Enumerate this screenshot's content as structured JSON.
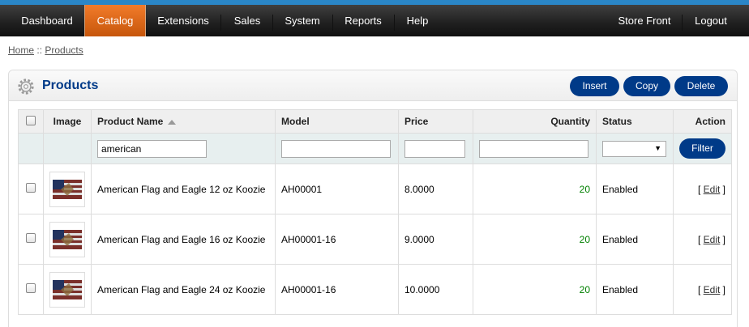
{
  "nav": {
    "left": [
      "Dashboard",
      "Catalog",
      "Extensions",
      "Sales",
      "System",
      "Reports",
      "Help"
    ],
    "right": [
      "Store Front",
      "Logout"
    ],
    "active": "Catalog"
  },
  "breadcrumb": {
    "home": "Home",
    "separator": "::",
    "current": "Products"
  },
  "panel": {
    "title": "Products",
    "buttons": {
      "insert": "Insert",
      "copy": "Copy",
      "delete": "Delete"
    }
  },
  "table": {
    "headers": {
      "image": "Image",
      "name": "Product Name",
      "model": "Model",
      "price": "Price",
      "quantity": "Quantity",
      "status": "Status",
      "action": "Action"
    },
    "filter": {
      "name": "american",
      "model": "",
      "price": "",
      "quantity": "",
      "status": "",
      "button": "Filter"
    },
    "rows": [
      {
        "name": "American Flag and Eagle 12 oz Koozie",
        "model": "AH00001",
        "price": "8.0000",
        "quantity": "20",
        "status": "Enabled",
        "action": "Edit"
      },
      {
        "name": "American Flag and Eagle 16 oz Koozie",
        "model": "AH00001-16",
        "price": "9.0000",
        "quantity": "20",
        "status": "Enabled",
        "action": "Edit"
      },
      {
        "name": "American Flag and Eagle 24 oz Koozie",
        "model": "AH00001-16",
        "price": "10.0000",
        "quantity": "20",
        "status": "Enabled",
        "action": "Edit"
      }
    ]
  },
  "colors": {
    "accent": "#003a88",
    "activeTab": "#e06a1a",
    "quantity": "#008000",
    "topBorder": "#2a86c7"
  }
}
